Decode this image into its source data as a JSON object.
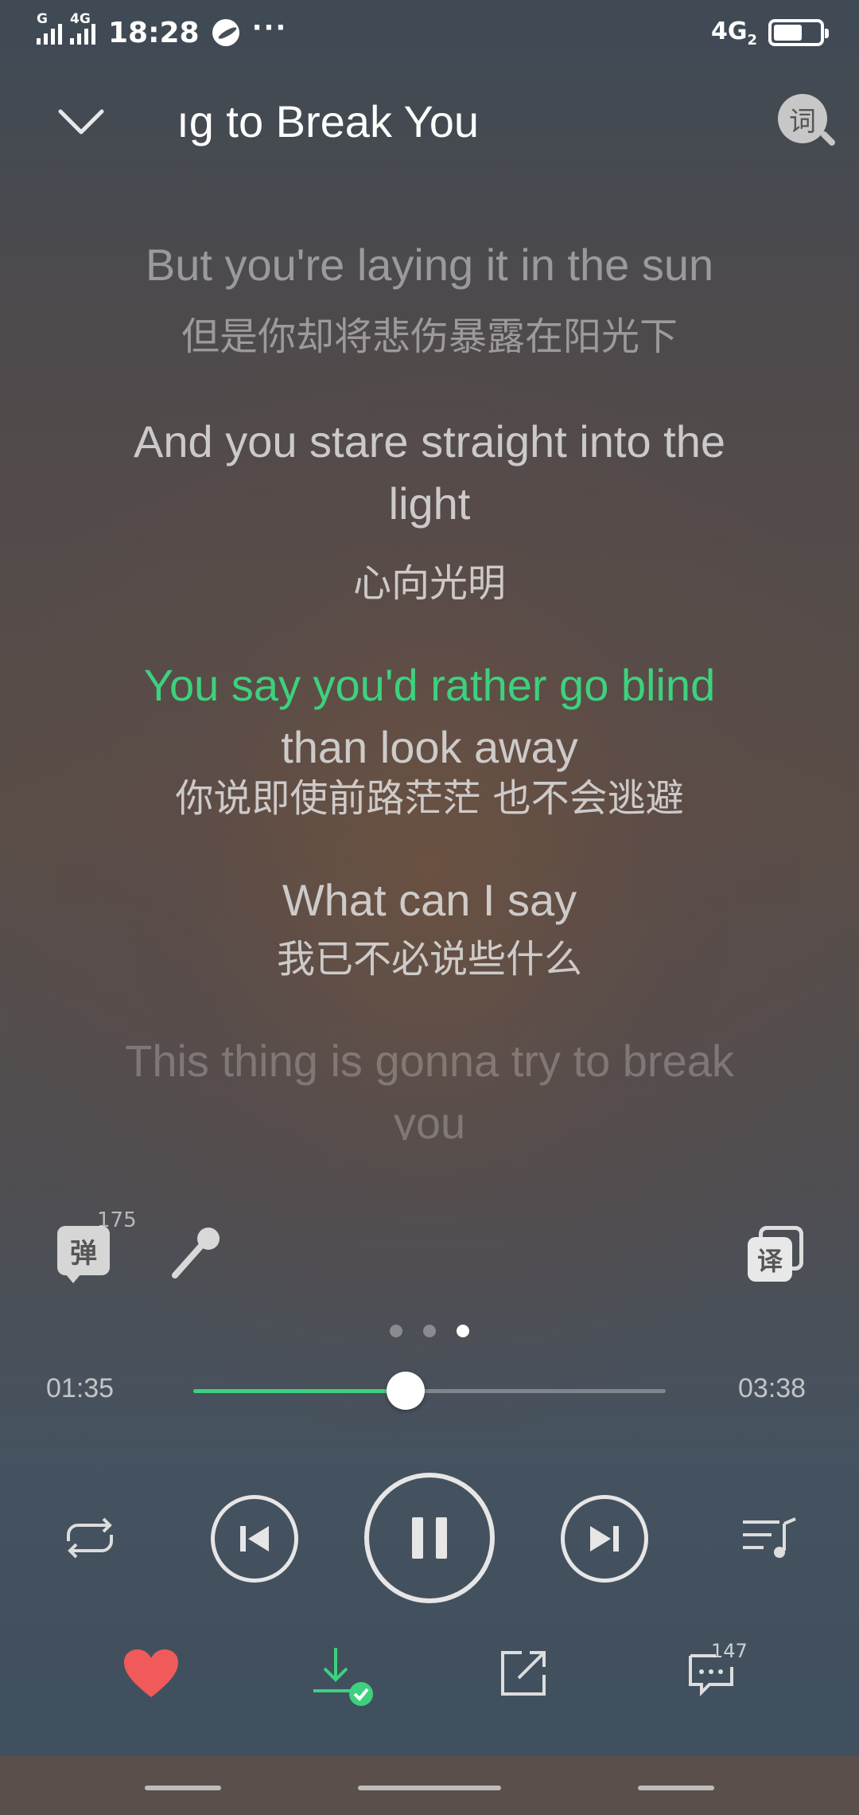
{
  "status_bar": {
    "sim1_tag": "G",
    "sim2_tag": "4G",
    "time": "18:28",
    "more": "···",
    "network": "4G",
    "network_sub": "2"
  },
  "header": {
    "title_visible": "ıg to Break You",
    "lyric_search_icon_glyph": "词"
  },
  "lyrics": [
    {
      "en": "But you're laying it in the sun",
      "zh": "但是你却将悲伤暴露在阳光下"
    },
    {
      "en": "And you stare straight into the light",
      "zh": "心向光明"
    },
    {
      "en_active": "You say you'd rather go blind",
      "en_rest": "than look away",
      "zh": "你说即使前路茫茫 也不会逃避"
    },
    {
      "en": "What can I say",
      "zh": "我已不必说些什么"
    },
    {
      "en": "This thing is gonna try to break you",
      "zh": ""
    }
  ],
  "tools": {
    "danmu_glyph": "弹",
    "danmu_count": "175",
    "translate_glyph": "译"
  },
  "pager": {
    "count": 3,
    "active_index": 2
  },
  "player": {
    "current_time": "01:35",
    "total_time": "03:38",
    "progress": 0.45
  },
  "bottom_actions": {
    "comment_count": "147"
  },
  "colors": {
    "accent": "#3dd17e",
    "heart": "#f05a5a"
  }
}
